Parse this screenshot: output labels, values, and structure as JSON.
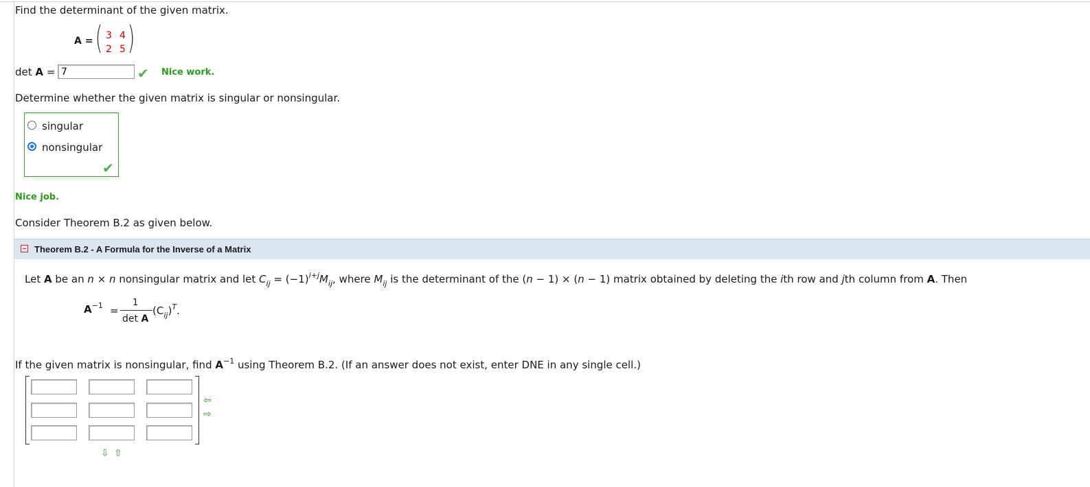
{
  "q1": {
    "prompt": "Find the determinant of the given matrix.",
    "matrix_label": "A =",
    "matrix": [
      [
        "3",
        "4"
      ],
      [
        "2",
        "5"
      ]
    ],
    "det_label": "det",
    "det_bold": "A",
    "det_eq": "=",
    "det_value": "7",
    "feedback": "Nice work."
  },
  "q2": {
    "prompt": "Determine whether the given matrix is singular or nonsingular.",
    "options": [
      "singular",
      "nonsingular"
    ],
    "selected": "nonsingular",
    "feedback": "Nice job."
  },
  "q3": {
    "intro": "Consider Theorem B.2 as given below.",
    "theorem_title": "Theorem B.2 - A Formula for the Inverse of a Matrix",
    "theorem_text_1": "Let",
    "theorem_A": "A",
    "theorem_text_2": "be an",
    "theorem_n1": "n",
    "theorem_times": "×",
    "theorem_n2": "n",
    "theorem_text_3": "nonsingular matrix and let",
    "theorem_C": "C",
    "theorem_ij": "ij",
    "theorem_eq": "= (−1)",
    "theorem_exp": "i+j",
    "theorem_M": "M",
    "theorem_text_4": ", where",
    "theorem_text_5": "is the determinant of the (",
    "theorem_text_6": "n",
    "theorem_text_7": " − 1) × (",
    "theorem_text_8": "n",
    "theorem_text_9": " − 1) matrix obtained by deleting the",
    "theorem_i": "i",
    "theorem_text_10": "th row and",
    "theorem_j": "j",
    "theorem_text_11": "th column from",
    "theorem_text_12": ". Then",
    "formula_lhs": "A",
    "formula_lhs_sup": "−1",
    "formula_eq": "=",
    "formula_num": "1",
    "formula_den_det": "det",
    "formula_den_A": "A",
    "formula_rhs": "(C",
    "formula_rhs_sub": "ij",
    "formula_rhs_close": ")",
    "formula_rhs_sup": "T",
    "formula_dot": "."
  },
  "q4": {
    "prompt_1": "If the given matrix is nonsingular, find",
    "prompt_A": "A",
    "prompt_sup": "−1",
    "prompt_2": "using Theorem B.2. (If an answer does not exist, enter DNE in any single cell.)",
    "cells": [
      [
        "",
        "",
        ""
      ],
      [
        "",
        "",
        ""
      ],
      [
        "",
        "",
        ""
      ]
    ],
    "row_arrows": [
      "⇦",
      "⇨"
    ],
    "col_arrows": [
      "⇩",
      "⇧"
    ]
  }
}
